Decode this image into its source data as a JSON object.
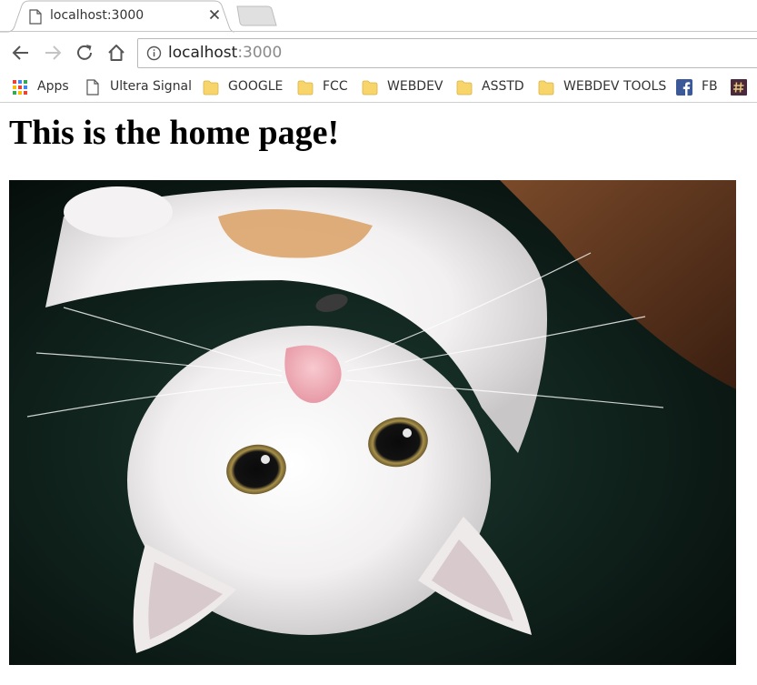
{
  "browser": {
    "tab": {
      "title": "localhost:3000"
    },
    "address_bar": {
      "host": "localhost",
      "port": ":3000"
    }
  },
  "bookmarks": [
    {
      "label": "Apps",
      "icon": "apps-grid-icon"
    },
    {
      "label": "Ultera Signal",
      "icon": "page-icon"
    },
    {
      "label": "GOOGLE",
      "icon": "folder-icon"
    },
    {
      "label": "FCC",
      "icon": "folder-icon"
    },
    {
      "label": "WEBDEV",
      "icon": "folder-icon"
    },
    {
      "label": "ASSTD",
      "icon": "folder-icon"
    },
    {
      "label": "WEBDEV TOOLS",
      "icon": "folder-icon"
    },
    {
      "label": "FB",
      "icon": "facebook-icon"
    },
    {
      "label": "",
      "icon": "hash-icon"
    }
  ],
  "page": {
    "heading": "This is the home page!",
    "image": {
      "subject": "white kitten lying upside down on dark green carpet"
    }
  },
  "colors": {
    "folder": "#f7d56b",
    "facebook": "#3b5998",
    "hash_bg": "#4a2a3a",
    "port_text": "#8a8a8a",
    "carpet": "#10201b"
  }
}
